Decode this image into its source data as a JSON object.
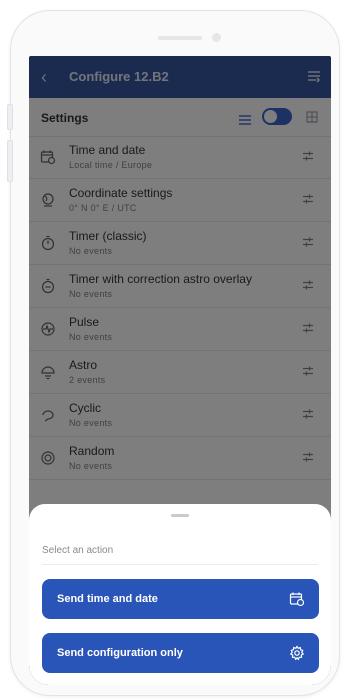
{
  "appbar": {
    "title": "Configure 12.B2",
    "back_icon": "back-arrow-icon",
    "menu_icon": "list-menu-icon"
  },
  "settings": {
    "label": "Settings",
    "toggle_on": true,
    "items": [
      {
        "title": "Time and date",
        "subtitle": "Local time / Europe",
        "icon": "calendar-clock-icon"
      },
      {
        "title": "Coordinate settings",
        "subtitle": "0° N 0° E / UTC",
        "icon": "globe-icon"
      },
      {
        "title": "Timer (classic)",
        "subtitle": "No events",
        "icon": "stopwatch-icon"
      },
      {
        "title": "Timer with correction astro overlay",
        "subtitle": "No events",
        "icon": "timer-astro-icon"
      },
      {
        "title": "Pulse",
        "subtitle": "No events",
        "icon": "pulse-icon"
      },
      {
        "title": "Astro",
        "subtitle": "2 events",
        "icon": "astro-icon"
      },
      {
        "title": "Cyclic",
        "subtitle": "No events",
        "icon": "cyclic-icon"
      },
      {
        "title": "Random",
        "subtitle": "No events",
        "icon": "random-icon"
      }
    ]
  },
  "action_sheet": {
    "label": "Select an action",
    "actions": [
      {
        "label": "Send time and date",
        "icon": "calendar-clock-icon"
      },
      {
        "label": "Send configuration only",
        "icon": "gear-icon"
      }
    ]
  },
  "colors": {
    "appbar": "#24489a",
    "button": "#2a55b8",
    "toggle": "#2a56c6"
  }
}
